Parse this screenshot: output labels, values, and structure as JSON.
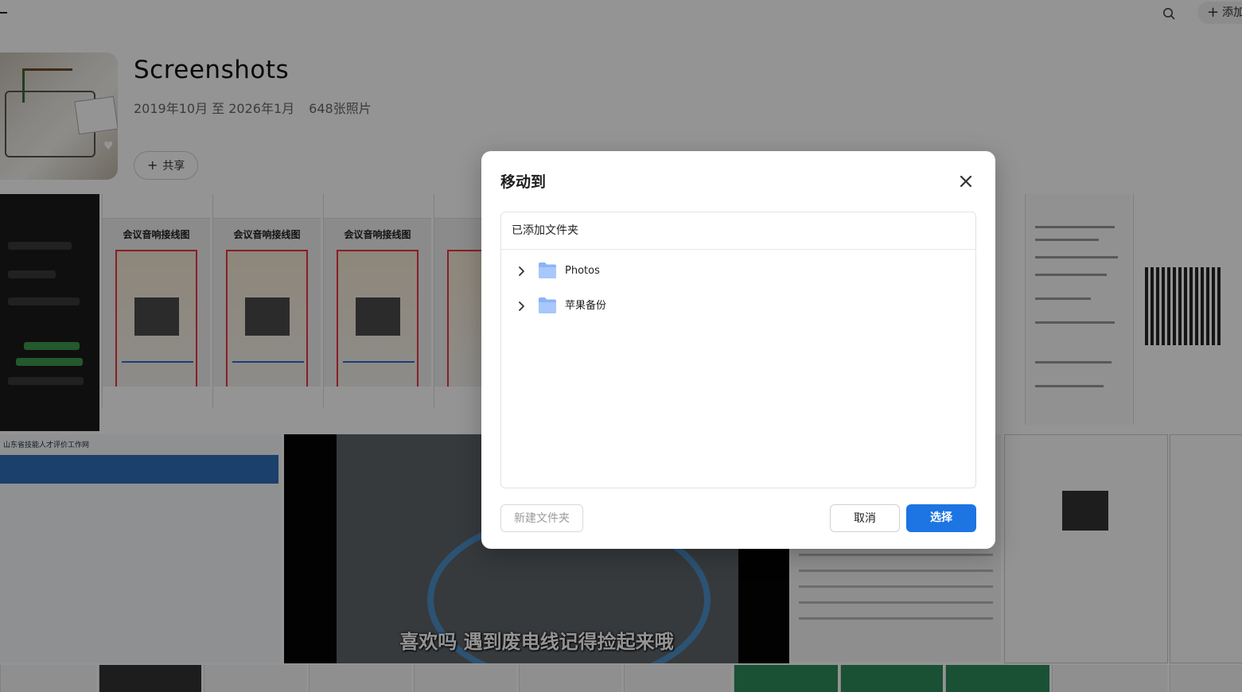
{
  "topbar": {
    "add_label": "添加"
  },
  "album": {
    "title": "Screenshots",
    "date_range": "2019年10月 至 2026年1月",
    "photo_count": "648张照片",
    "share_label": "共享"
  },
  "thumbnails": {
    "poster_title": "会议音响接线图",
    "video_caption": "喜欢吗 遇到废电线记得捡起来哦",
    "form_header": "山东省技能人才评价工作网"
  },
  "dialog": {
    "title": "移动到",
    "section_header": "已添加文件夹",
    "folders": [
      {
        "name": "Photos"
      },
      {
        "name": "苹果备份"
      }
    ],
    "new_folder_label": "新建文件夹",
    "cancel_label": "取消",
    "select_label": "选择"
  },
  "colors": {
    "accent": "#1d74e3",
    "folder": "#8ab4f8"
  },
  "icons": {
    "close": "close-icon",
    "expand": "chevron-right-icon",
    "folder": "folder-icon",
    "search": "search-icon"
  }
}
